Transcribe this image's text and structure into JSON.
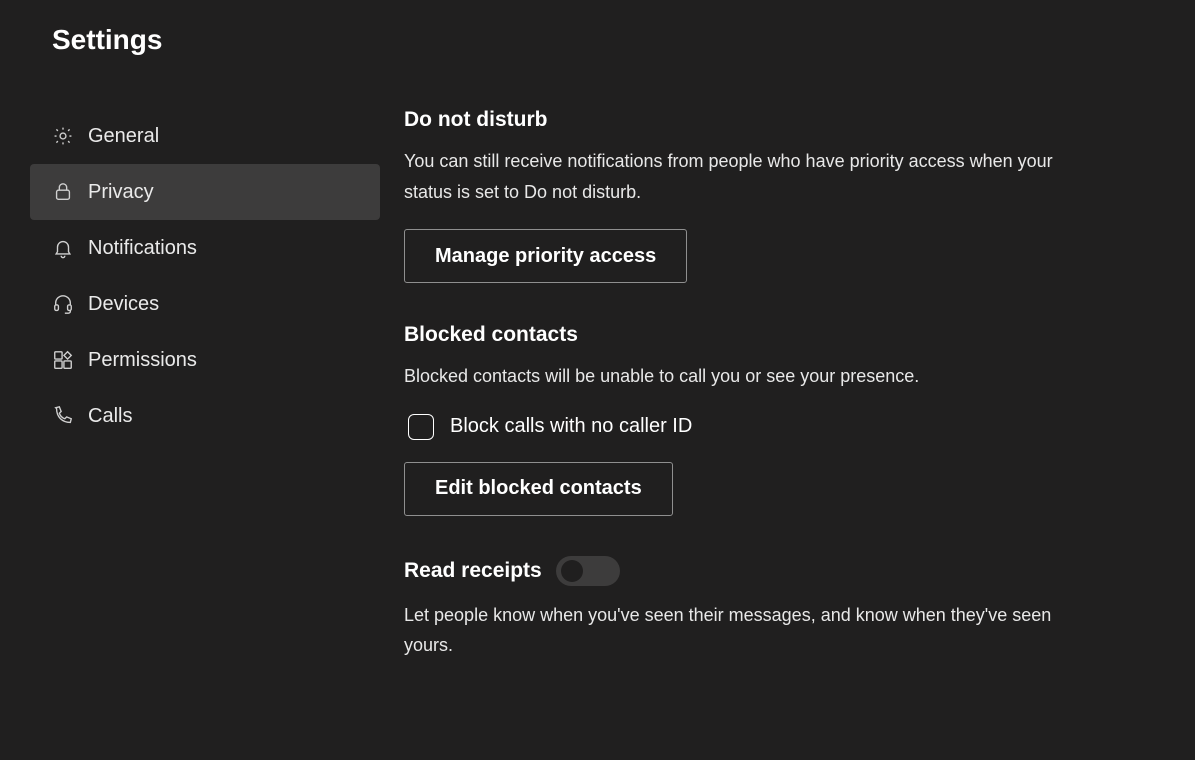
{
  "page_title": "Settings",
  "sidebar": {
    "items": [
      {
        "label": "General",
        "icon": "gear-icon",
        "active": false
      },
      {
        "label": "Privacy",
        "icon": "lock-icon",
        "active": true
      },
      {
        "label": "Notifications",
        "icon": "bell-icon",
        "active": false
      },
      {
        "label": "Devices",
        "icon": "headset-icon",
        "active": false
      },
      {
        "label": "Permissions",
        "icon": "apps-icon",
        "active": false
      },
      {
        "label": "Calls",
        "icon": "phone-icon",
        "active": false
      }
    ]
  },
  "content": {
    "dnd": {
      "heading": "Do not disturb",
      "description": "You can still receive notifications from people who have priority access when your status is set to Do not disturb.",
      "button": "Manage priority access"
    },
    "blocked": {
      "heading": "Blocked contacts",
      "description": "Blocked contacts will be unable to call you or see your presence.",
      "checkbox_label": "Block calls with no caller ID",
      "checkbox_checked": false,
      "button": "Edit blocked contacts"
    },
    "receipts": {
      "heading": "Read receipts",
      "toggle_on": false,
      "description": "Let people know when you've seen their messages, and know when they've seen yours."
    }
  }
}
